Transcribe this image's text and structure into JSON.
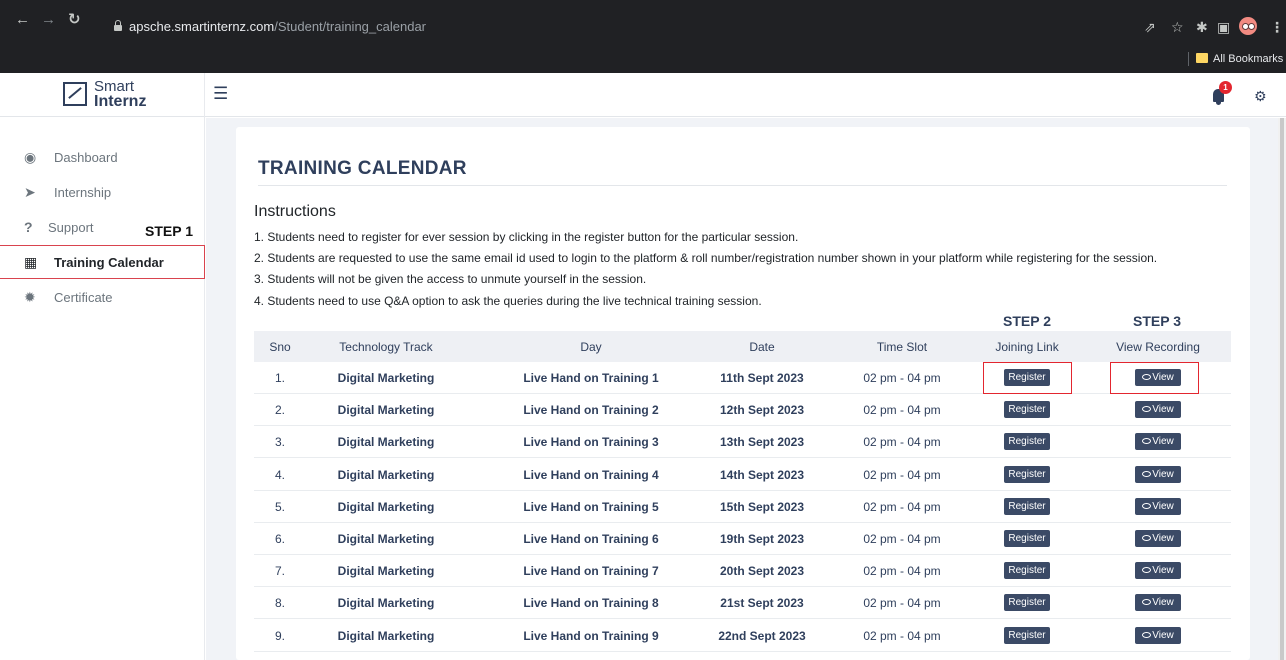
{
  "browser": {
    "url_host": "apsche.smartinternz.com",
    "url_path": "/Student/training_calendar",
    "bookmarks_label": "All Bookmarks"
  },
  "app": {
    "logo_line1": "Smart",
    "logo_line2": "Internz",
    "notification_count": "1"
  },
  "sidebar": {
    "items": [
      {
        "label": "Dashboard",
        "icon": "dashboard-icon"
      },
      {
        "label": "Internship",
        "icon": "paper-plane-icon"
      },
      {
        "label": "Support",
        "icon": "question-icon"
      },
      {
        "label": "Training Calendar",
        "icon": "calendar-icon"
      },
      {
        "label": "Certificate",
        "icon": "certificate-icon"
      }
    ],
    "step_label": "STEP 1"
  },
  "main": {
    "title": "TRAINING CALENDAR",
    "instructions_heading": "Instructions",
    "instructions": [
      "1. Students need to register for ever session by clicking in the register button for the particular session.",
      "2. Students are requested to use the same email id used to login to the platform & roll number/registration number shown in your platform while registering for the session.",
      "3. Students will not be given the access to unmute yourself in the session.",
      "4. Students need to use Q&A option to ask the queries during the live technical training session."
    ],
    "step2_label": "STEP 2",
    "step3_label": "STEP 3",
    "columns": [
      "Sno",
      "Technology Track",
      "Day",
      "Date",
      "Time Slot",
      "Joining Link",
      "View Recording"
    ],
    "register_label": "Register",
    "view_label": "View",
    "rows": [
      {
        "sno": "1.",
        "track": "Digital Marketing",
        "day": "Live Hand on Training 1",
        "date": "11th Sept 2023",
        "slot": "02 pm - 04 pm"
      },
      {
        "sno": "2.",
        "track": "Digital Marketing",
        "day": "Live Hand on Training 2",
        "date": "12th Sept 2023",
        "slot": "02 pm - 04 pm"
      },
      {
        "sno": "3.",
        "track": "Digital Marketing",
        "day": "Live Hand on Training 3",
        "date": "13th Sept 2023",
        "slot": "02 pm - 04 pm"
      },
      {
        "sno": "4.",
        "track": "Digital Marketing",
        "day": "Live Hand on Training 4",
        "date": "14th Sept 2023",
        "slot": "02 pm - 04 pm"
      },
      {
        "sno": "5.",
        "track": "Digital Marketing",
        "day": "Live Hand on Training 5",
        "date": "15th Sept 2023",
        "slot": "02 pm - 04 pm"
      },
      {
        "sno": "6.",
        "track": "Digital Marketing",
        "day": "Live Hand on Training 6",
        "date": "19th Sept 2023",
        "slot": "02 pm - 04 pm"
      },
      {
        "sno": "7.",
        "track": "Digital Marketing",
        "day": "Live Hand on Training 7",
        "date": "20th Sept 2023",
        "slot": "02 pm - 04 pm"
      },
      {
        "sno": "8.",
        "track": "Digital Marketing",
        "day": "Live Hand on Training 8",
        "date": "21st Sept 2023",
        "slot": "02 pm - 04 pm"
      },
      {
        "sno": "9.",
        "track": "Digital Marketing",
        "day": "Live Hand on Training 9",
        "date": "22nd Sept 2023",
        "slot": "02 pm - 04 pm"
      }
    ]
  },
  "colors": {
    "navy": "#2f3f5c",
    "button": "#3b4a66",
    "highlight": "#e3262f",
    "page_bg": "#f1f3f7"
  }
}
